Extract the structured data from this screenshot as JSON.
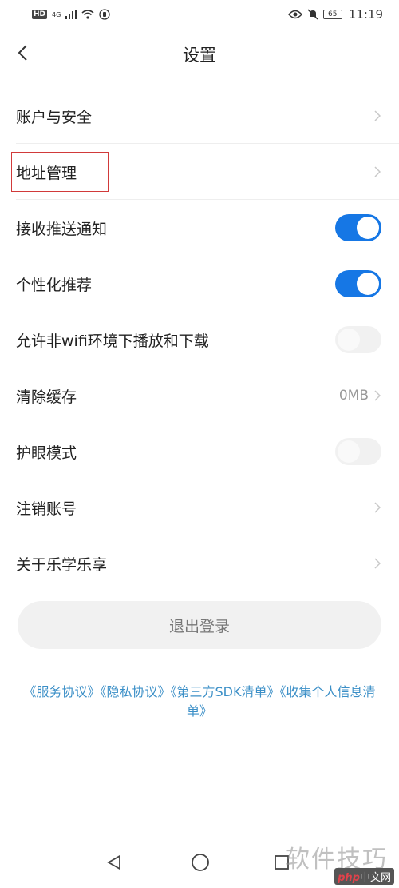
{
  "status_bar": {
    "hd_badge": "HD",
    "network": "4G",
    "battery": "65",
    "time": "11:19"
  },
  "header": {
    "title": "设置"
  },
  "settings": {
    "account_security": "账户与安全",
    "address_management": "地址管理",
    "push_notifications": {
      "label": "接收推送通知",
      "enabled": true
    },
    "personalized_recommendations": {
      "label": "个性化推荐",
      "enabled": true
    },
    "non_wifi_playback": {
      "label": "允许非wifi环境下播放和下载",
      "enabled": false
    },
    "clear_cache": {
      "label": "清除缓存",
      "value": "0MB"
    },
    "eye_protection": {
      "label": "护眼模式",
      "enabled": false
    },
    "deactivate_account": "注销账号",
    "about": "关于乐学乐享"
  },
  "logout_label": "退出登录",
  "agreements": {
    "service": "《服务协议》",
    "privacy": "《隐私协议》",
    "sdk_list": "《第三方SDK清单》",
    "info_list": "《收集个人信息清单》"
  },
  "watermark": {
    "text": "软件技巧",
    "site_a": "php",
    "site_b": "中文网"
  },
  "colors": {
    "accent": "#1677e5",
    "link": "#3b8fc7",
    "highlight": "#d13a3a"
  }
}
